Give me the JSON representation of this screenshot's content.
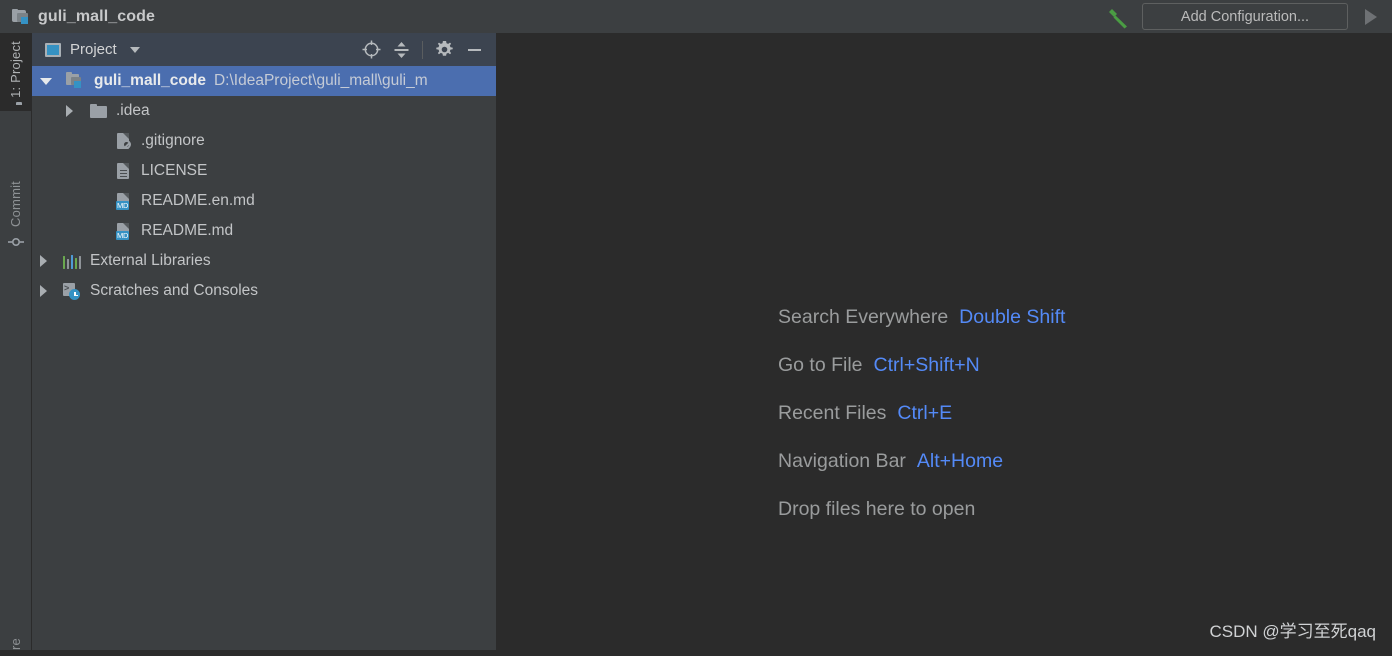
{
  "titlebar": {
    "project_name": "guli_mall_code",
    "project_icon": "module-folder-icon",
    "build_icon": "hammer-icon",
    "add_configuration_label": "Add Configuration...",
    "run_icon": "run-triangle-icon"
  },
  "left_strip": {
    "tabs": [
      {
        "label": "1: Project",
        "icon": "folder-icon",
        "selected": true
      },
      {
        "label": "Commit",
        "icon": "commit-icon",
        "selected": false
      },
      {
        "label": "re",
        "icon": "structure-icon",
        "selected": false
      }
    ]
  },
  "project_panel": {
    "header": {
      "view_label": "Project",
      "view_icon": "project-view-icon",
      "dropdown_icon": "chevron-down-icon",
      "tools": [
        {
          "name": "select-opened-file-icon",
          "glyph": "target"
        },
        {
          "name": "collapse-all-icon",
          "glyph": "collapse"
        },
        {
          "name": "settings-gear-icon",
          "glyph": "gear"
        },
        {
          "name": "hide-panel-icon",
          "glyph": "minus"
        }
      ]
    },
    "tree": [
      {
        "label": "guli_mall_code",
        "path": "D:\\IdeaProject\\guli_mall\\guli_m",
        "icon": "module-folder-icon",
        "indent": 0,
        "expanded": true,
        "selected": true,
        "bold": true
      },
      {
        "label": ".idea",
        "icon": "folder-icon",
        "indent": 1,
        "expanded": false,
        "selected": false,
        "bold": false
      },
      {
        "label": ".gitignore",
        "icon": "gitignore-file-icon",
        "indent": 2,
        "expanded": null,
        "selected": false,
        "bold": false
      },
      {
        "label": "LICENSE",
        "icon": "text-file-icon",
        "indent": 2,
        "expanded": null,
        "selected": false,
        "bold": false
      },
      {
        "label": "README.en.md",
        "icon": "markdown-file-icon",
        "indent": 2,
        "expanded": null,
        "selected": false,
        "bold": false
      },
      {
        "label": "README.md",
        "icon": "markdown-file-icon",
        "indent": 2,
        "expanded": null,
        "selected": false,
        "bold": false
      },
      {
        "label": "External Libraries",
        "icon": "libraries-icon",
        "indent": 0,
        "expanded": false,
        "selected": false,
        "bold": false
      },
      {
        "label": "Scratches and Consoles",
        "icon": "scratches-icon",
        "indent": 0,
        "expanded": false,
        "selected": false,
        "bold": false
      }
    ]
  },
  "editor": {
    "hints": [
      {
        "action": "Search Everywhere",
        "key": "Double Shift"
      },
      {
        "action": "Go to File",
        "key": "Ctrl+Shift+N"
      },
      {
        "action": "Recent Files",
        "key": "Ctrl+E"
      },
      {
        "action": "Navigation Bar",
        "key": "Alt+Home"
      },
      {
        "action": "Drop files here to open",
        "key": ""
      }
    ],
    "watermark": "CSDN @学习至死qaq"
  },
  "colors": {
    "chrome": "#3c3f41",
    "editor_bg": "#2b2b2b",
    "selection_blue": "#4b6eaf",
    "link_blue": "#548af7",
    "accent_teal": "#3592c4",
    "text_primary": "#c3c5c7",
    "text_dim": "#9a9c9d"
  }
}
